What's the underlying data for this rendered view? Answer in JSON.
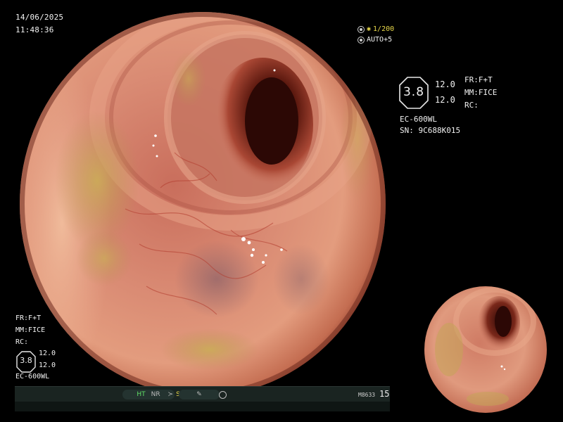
{
  "overlay": {
    "date": "14/06/2025",
    "time": "11:48:36"
  },
  "shutter": {
    "speed": "1/200",
    "auto": "AUTO+5"
  },
  "right_panel": {
    "zoom_badge": "3.8",
    "value_a": "12.0",
    "value_b": "12.0",
    "fr": "FR:F+T",
    "mm": "MM:FICE",
    "rc": "RC:",
    "scope_model": "EC-600WL",
    "serial": "SN: 9C688K015"
  },
  "left_panel": {
    "fr": "FR:F+T",
    "mm": "MM:FICE",
    "rc": "RC:",
    "zoom_badge": "3.8",
    "value_a": "12.0",
    "value_b": "12.0",
    "scope_model": "EC-600WL"
  },
  "status_bar": {
    "ht": "HT",
    "nr": "NR",
    "se": "SE",
    "id_text": "M8633",
    "counter": "15"
  },
  "colors": {
    "tissue_base": "#d88870",
    "lumen_dark": "#3a0b06",
    "status_green": "#61e067",
    "status_yellow": "#e8d84a"
  },
  "icons": [
    "shutter-icon",
    "auto-icon",
    "se-icon",
    "pen-icon",
    "record-icon"
  ]
}
